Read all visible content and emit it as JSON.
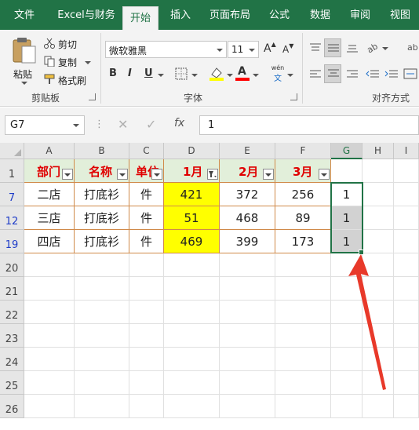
{
  "ribbon_tabs": [
    "文件",
    "Excel与财务",
    "开始",
    "插入",
    "页面布局",
    "公式",
    "数据",
    "审阅",
    "视图"
  ],
  "active_tab": "开始",
  "clipboard": {
    "paste": "粘贴",
    "cut": "剪切",
    "copy": "复制",
    "format_painter": "格式刷",
    "group_label": "剪贴板"
  },
  "font": {
    "family": "微软雅黑",
    "size": "11",
    "group_label": "字体",
    "bold": "B",
    "italic": "I",
    "underline": "U",
    "phonetic_top": "wén",
    "phonetic_bottom": "文",
    "grow": "A",
    "shrink": "A"
  },
  "alignment": {
    "group_label": "对齐方式"
  },
  "formula_bar": {
    "name_box": "G7",
    "fx": "fx",
    "value": "1"
  },
  "columns": [
    "A",
    "B",
    "C",
    "D",
    "E",
    "F",
    "G",
    "H",
    "I"
  ],
  "selected_column": "G",
  "table_headers": [
    "部门",
    "名称",
    "单位",
    "1月",
    "2月",
    "3月"
  ],
  "rows": [
    {
      "row_num": "7",
      "filtered": true,
      "cells": [
        "二店",
        "打底衫",
        "件",
        "421",
        "372",
        "256",
        "1"
      ]
    },
    {
      "row_num": "12",
      "filtered": true,
      "cells": [
        "三店",
        "打底衫",
        "件",
        "51",
        "468",
        "89",
        "1"
      ]
    },
    {
      "row_num": "19",
      "filtered": true,
      "cells": [
        "四店",
        "打底衫",
        "件",
        "469",
        "399",
        "173",
        "1"
      ]
    }
  ],
  "header_row_num": "1",
  "empty_rows": [
    "20",
    "21",
    "22",
    "23",
    "24",
    "25",
    "26"
  ],
  "colors": {
    "accent": "#217346",
    "header_fill": "#e2efda",
    "header_text": "#e00000",
    "highlight": "#ffff00",
    "border": "#d08a4a",
    "arrow": "#e8392a"
  }
}
